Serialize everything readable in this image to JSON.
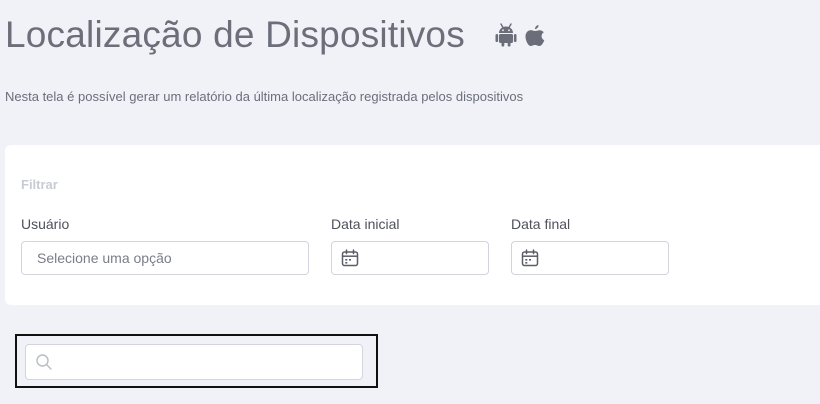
{
  "header": {
    "title": "Localização de Dispositivos",
    "platform_icons": [
      "android-icon",
      "apple-icon"
    ],
    "subtitle": "Nesta tela é possível gerar um relatório da última localização registrada pelos dispositivos"
  },
  "filter": {
    "heading": "Filtrar",
    "user": {
      "label": "Usuário",
      "placeholder": "Selecione uma opção"
    },
    "start_date": {
      "label": "Data inicial",
      "value": "",
      "icon": "calendar-icon"
    },
    "end_date": {
      "label": "Data final",
      "value": "",
      "icon": "calendar-icon"
    }
  },
  "search": {
    "value": "",
    "icon": "search-icon"
  },
  "colors": {
    "background": "#f1f2f7",
    "card": "#ffffff",
    "title": "#6c6e7a",
    "icon": "#6b6d78"
  }
}
